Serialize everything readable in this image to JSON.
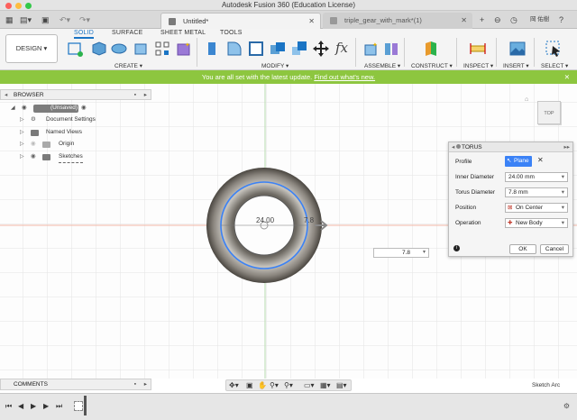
{
  "window": {
    "title": "Autodesk Fusion 360 (Education License)"
  },
  "tabs": [
    {
      "label": "Untitled*",
      "active": true
    },
    {
      "label": "triple_gear_with_mark*(1)",
      "active": false
    }
  ],
  "user": {
    "name": "岡 佑樹"
  },
  "toolbar": {
    "workspace": "DESIGN",
    "workspace_tabs": [
      "SOLID",
      "SURFACE",
      "SHEET METAL",
      "TOOLS"
    ],
    "groups": {
      "create": "CREATE",
      "modify": "MODIFY",
      "assemble": "ASSEMBLE",
      "construct": "CONSTRUCT",
      "inspect": "INSPECT",
      "insert": "INSERT",
      "select": "SELECT"
    },
    "fx_label": "fx"
  },
  "banner": {
    "text": "You are all set with the latest update.",
    "link": "Find out what's new."
  },
  "browser": {
    "title": "BROWSER",
    "root": "(Unsaved)",
    "items": [
      "Document Settings",
      "Named Views",
      "Origin",
      "Sketches"
    ]
  },
  "viewcube": {
    "label": "TOP"
  },
  "canvas": {
    "inner_dim": "24.00",
    "torus_dim": "7.8",
    "input_value": "7.8"
  },
  "dialog": {
    "title": "TORUS",
    "fields": [
      {
        "label": "Profile",
        "value": "Plane"
      },
      {
        "label": "Inner Diameter",
        "value": "24.00 mm"
      },
      {
        "label": "Torus Diameter",
        "value": "7.8 mm"
      },
      {
        "label": "Position",
        "value": "On Center"
      },
      {
        "label": "Operation",
        "value": "New Body"
      }
    ],
    "ok": "OK",
    "cancel": "Cancel"
  },
  "comments": {
    "title": "COMMENTS"
  },
  "status": {
    "text": "Sketch Arc"
  },
  "colors": {
    "banner": "#8dc63f",
    "accent": "#1a74c4",
    "selection": "#3b82f6"
  }
}
